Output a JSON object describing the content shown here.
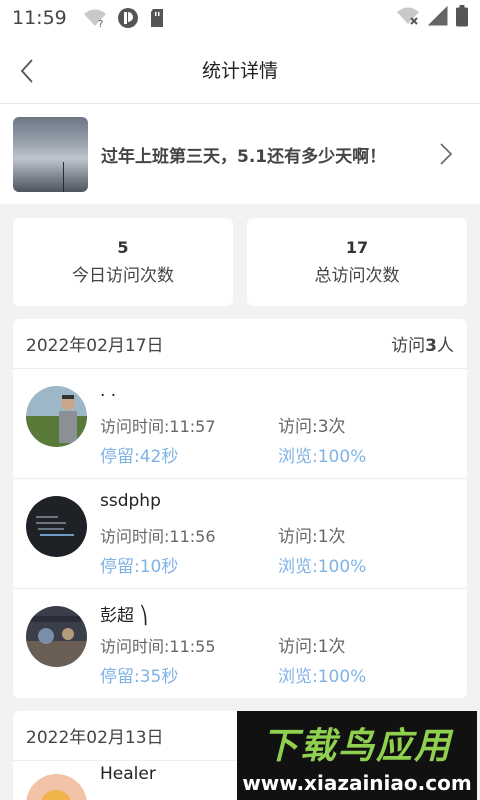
{
  "status_bar": {
    "time": "11:59",
    "icons_left": [
      "wifi-question-icon",
      "app-icon",
      "sim-card-icon"
    ],
    "icons_right": [
      "wifi-off-icon",
      "signal-icon",
      "battery-icon"
    ]
  },
  "navbar": {
    "title": "统计详情",
    "back_icon": "chevron-left-icon"
  },
  "article": {
    "title": "过年上班第三天，5.1还有多少天啊！",
    "arrow_icon": "chevron-right-icon"
  },
  "stats": [
    {
      "value": "5",
      "label": "今日访问次数"
    },
    {
      "value": "17",
      "label": "总访问次数"
    }
  ],
  "days": [
    {
      "date": "2022年02月17日",
      "count_prefix": "访问",
      "count_value": "3",
      "count_suffix": "人",
      "visitors": [
        {
          "name": ".        .",
          "time": "访问时间:11:57",
          "times": "访问:3次",
          "stay": "停留:42秒",
          "browse": "浏览:100%"
        },
        {
          "name": "ssdphp",
          "time": "访问时间:11:56",
          "times": "访问:1次",
          "stay": "停留:10秒",
          "browse": "浏览:100%"
        },
        {
          "name": "彭超      ⎞",
          "time": "访问时间:11:55",
          "times": "访问:1次",
          "stay": "停留:35秒",
          "browse": "浏览:100%"
        }
      ]
    },
    {
      "date": "2022年02月13日",
      "visitors": [
        {
          "name": "Healer"
        }
      ]
    }
  ],
  "watermark": {
    "title": "下载鸟应用",
    "url": "www.xiazainiao.com"
  },
  "colors": {
    "accent_blue": "#7fb2e5",
    "background": "#f2f2f2",
    "watermark_green": "#8fd14f"
  }
}
